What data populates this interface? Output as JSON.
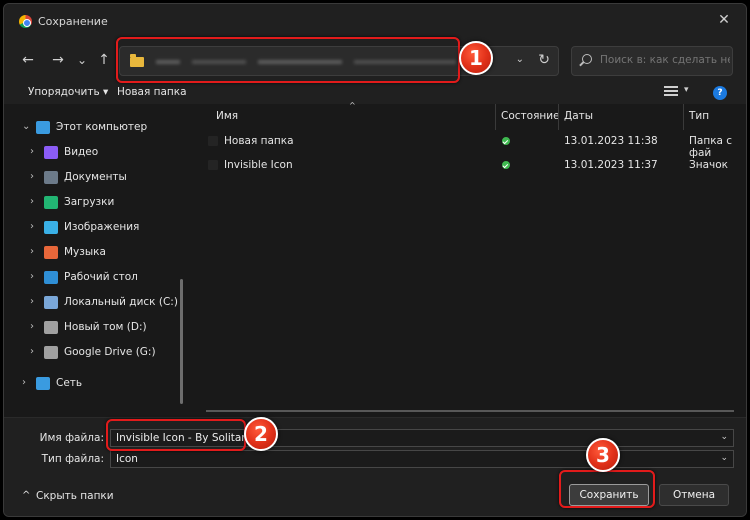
{
  "window": {
    "title": "Сохранение",
    "close": "✕"
  },
  "nav": {
    "back": "←",
    "forward": "→",
    "recent": "⌄",
    "up": "↑",
    "address_chevron": "⌄",
    "refresh": "↻",
    "search_placeholder": "Поиск в: как сделать невид..."
  },
  "toolbar": {
    "organize": "Упорядочить ▾",
    "new_folder": "Новая папка",
    "view_chevron": "▾",
    "help": "?"
  },
  "sidebar": {
    "items": [
      {
        "label": "Этот компьютер",
        "icon": "monitor-icon",
        "color": "#3a9be0",
        "chev": "⌄"
      },
      {
        "label": "Видео",
        "icon": "video-icon",
        "color": "#8b5cf6",
        "chev": "›"
      },
      {
        "label": "Документы",
        "icon": "documents-icon",
        "color": "#6c7a89",
        "chev": "›"
      },
      {
        "label": "Загрузки",
        "icon": "downloads-icon",
        "color": "#22b573",
        "chev": "›"
      },
      {
        "label": "Изображения",
        "icon": "pictures-icon",
        "color": "#3ab0e6",
        "chev": "›"
      },
      {
        "label": "Музыка",
        "icon": "music-icon",
        "color": "#e8673a",
        "chev": "›"
      },
      {
        "label": "Рабочий стол",
        "icon": "desktop-icon",
        "color": "#2f8fd6",
        "chev": "›"
      },
      {
        "label": "Локальный диск (C:)",
        "icon": "drive-c-icon",
        "color": "#7aa7d8",
        "chev": "›"
      },
      {
        "label": "Новый том (D:)",
        "icon": "drive-icon",
        "color": "#a0a0a0",
        "chev": "›"
      },
      {
        "label": "Google Drive (G:)",
        "icon": "drive-icon",
        "color": "#a0a0a0",
        "chev": "›"
      },
      {
        "label": "Сеть",
        "icon": "network-icon",
        "color": "#3a9be0",
        "chev": "›"
      }
    ]
  },
  "columns": {
    "name": "Имя",
    "status": "Состояние",
    "date": "Даты",
    "type": "Тип",
    "sort": "^"
  },
  "files": [
    {
      "name": "Новая папка",
      "date": "13.01.2023 11:38",
      "type": "Папка с фай"
    },
    {
      "name": "Invisible Icon",
      "date": "13.01.2023 11:37",
      "type": "Значок"
    }
  ],
  "form": {
    "filename_label": "Имя файла:",
    "filename_value": "Invisible Icon - By Solitary Jay",
    "filetype_label": "Тип файла:",
    "filetype_value": "Icon",
    "chevron": "⌄",
    "hide_folders": "Скрыть папки",
    "hide_chev": "^",
    "save": "Сохранить",
    "cancel": "Отмена"
  },
  "annotations": {
    "badge1": "1",
    "badge2": "2",
    "badge3": "3",
    "color": "#e21b1b"
  }
}
